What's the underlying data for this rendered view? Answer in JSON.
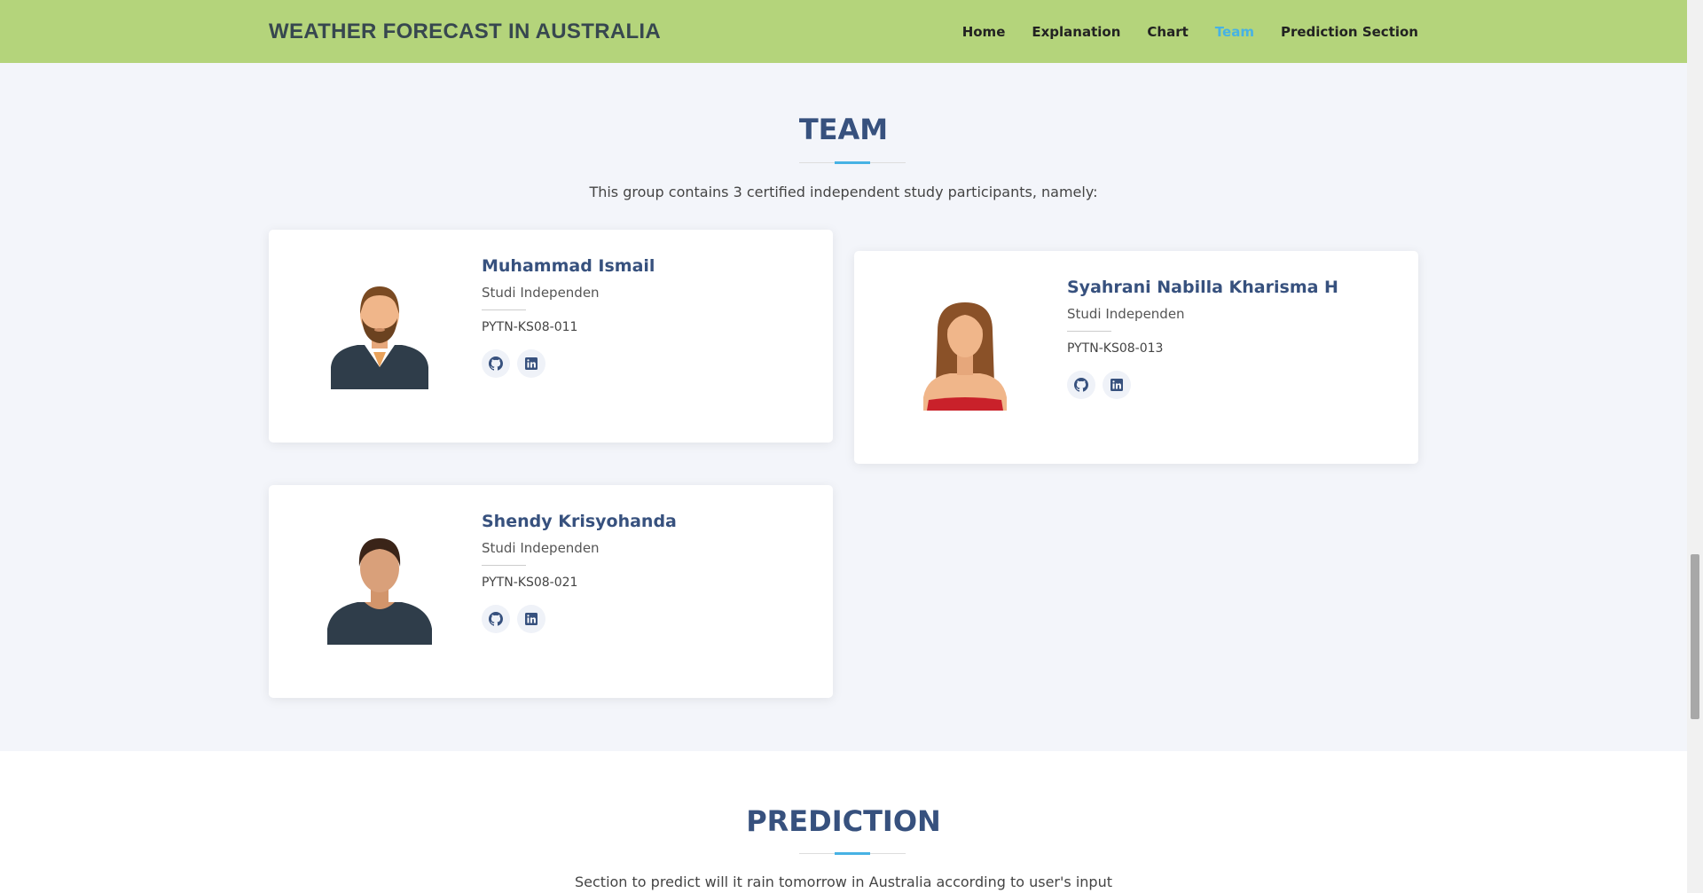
{
  "header": {
    "logo": "WEATHER FORECAST IN AUSTRALIA",
    "nav": [
      "Home",
      "Explanation",
      "Chart",
      "Team",
      "Prediction Section"
    ],
    "active_nav": "Team"
  },
  "team": {
    "title": "TEAM",
    "subtitle": "This group contains 3 certified independent study participants, namely:",
    "members": [
      {
        "name": "Muhammad Ismail",
        "role": "Studi Independen",
        "code": "PYTN-KS08-011",
        "avatar": "male-bearded-avatar"
      },
      {
        "name": "Syahrani Nabilla Kharisma H",
        "role": "Studi Independen",
        "code": "PYTN-KS08-013",
        "avatar": "female-avatar"
      },
      {
        "name": "Shendy Krisyohanda",
        "role": "Studi Independen",
        "code": "PYTN-KS08-021",
        "avatar": "male-avatar"
      }
    ],
    "social_icons": [
      "github-icon",
      "linkedin-icon"
    ]
  },
  "prediction": {
    "title": "PREDICTION",
    "subtitle": "Section to predict will it rain tomorrow in Australia according to user's input"
  },
  "colors": {
    "header_bg": "#b4d47b",
    "title": "#37517e",
    "accent": "#47b2e4",
    "section_bg": "#f3f5fa"
  }
}
